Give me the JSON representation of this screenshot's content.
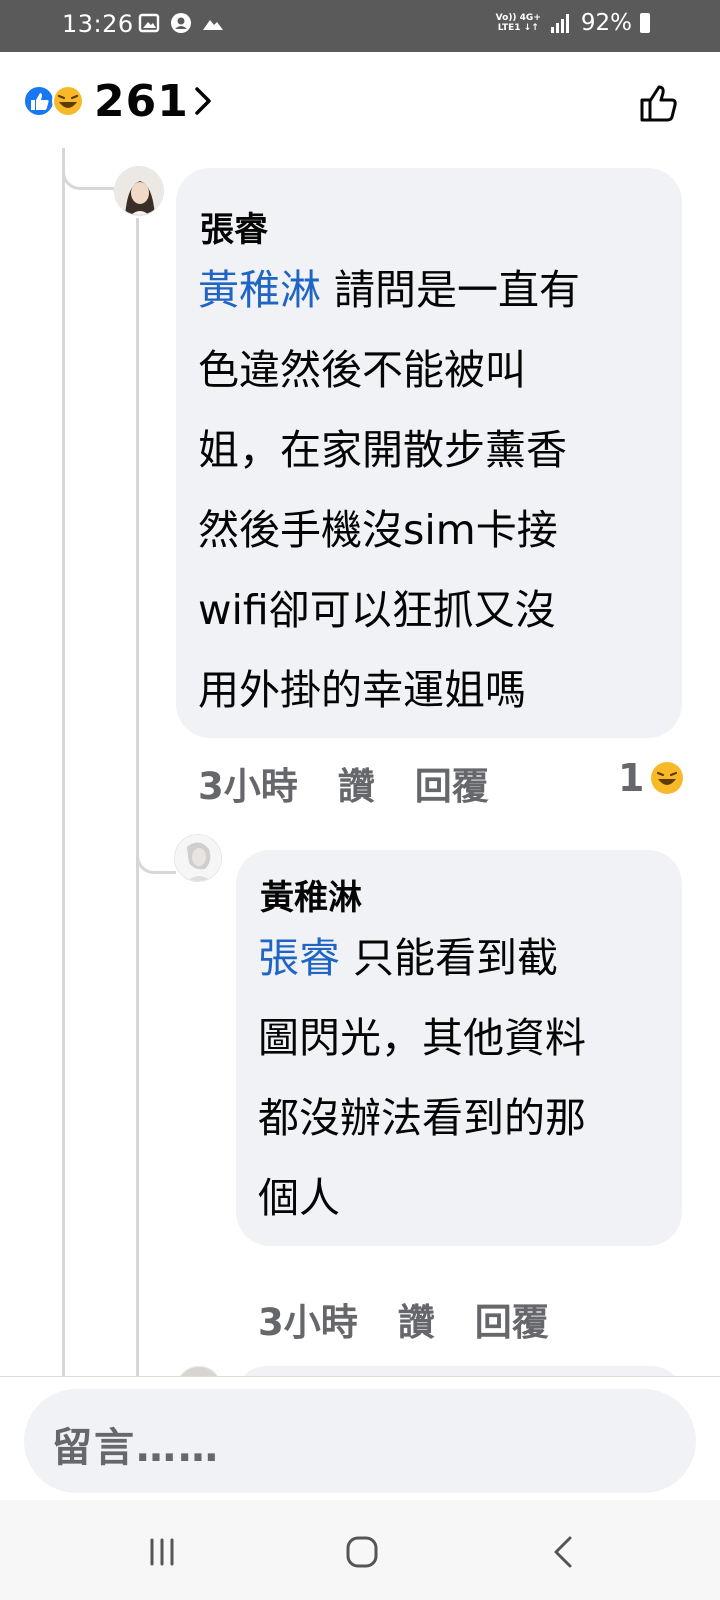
{
  "status_bar": {
    "time": "13:26",
    "network_line1": "Vo)) 4G+",
    "network_line2": "LTE1 ↓↑",
    "battery": "92%"
  },
  "header": {
    "reaction_count": "261",
    "reaction_icons": [
      "like-icon",
      "laugh-icon"
    ]
  },
  "comments": [
    {
      "author": "張睿",
      "mention": "黃稚淋",
      "lines": [
        "請問是一直有",
        "色違然後不能被叫",
        "姐，在家開散步薰香",
        "然後手機沒sim卡接",
        "wifi卻可以狂抓又沒",
        "用外掛的幸運姐嗎"
      ],
      "time": "3小時",
      "like_label": "讚",
      "reply_label": "回覆",
      "reaction_count": "1",
      "reaction_icon": "laugh-icon"
    },
    {
      "author": "黃稚淋",
      "mention": "張睿",
      "lines": [
        "只能看到截",
        "圖閃光，其他資料",
        "都沒辦法看到的那",
        "個人"
      ],
      "time": "3小時",
      "like_label": "讚",
      "reply_label": "回覆"
    }
  ],
  "composer": {
    "placeholder": "留言……"
  },
  "colors": {
    "status_bar": "#5a5a5a",
    "bubble": "#f0f2f5",
    "mention": "#2065c4",
    "meta": "#65676b",
    "like_blue": "#1877f2",
    "haha_yellow": "#f7b928"
  }
}
